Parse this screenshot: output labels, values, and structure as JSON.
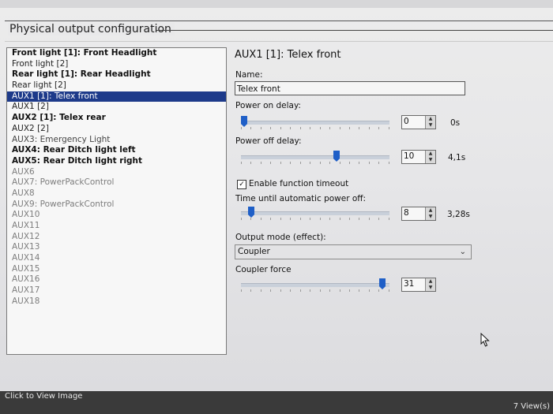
{
  "section_title": "Physical output configuration",
  "outputs": [
    {
      "label": "Front light [1]: Front Headlight",
      "style": "bold"
    },
    {
      "label": "Front light [2]",
      "style": "normal"
    },
    {
      "label": "Rear light [1]: Rear Headlight",
      "style": "bold"
    },
    {
      "label": "Rear light [2]",
      "style": "normal"
    },
    {
      "label": "AUX1 [1]: Telex front",
      "style": "selected"
    },
    {
      "label": "AUX1 [2]",
      "style": "normal"
    },
    {
      "label": "AUX2 [1]: Telex rear",
      "style": "bold"
    },
    {
      "label": "AUX2 [2]",
      "style": "normal"
    },
    {
      "label": "AUX3: Emergency Light",
      "style": "dark"
    },
    {
      "label": "AUX4: Rear Ditch light left",
      "style": "bold"
    },
    {
      "label": "AUX5: Rear Ditch light right",
      "style": "bold"
    },
    {
      "label": "AUX6",
      "style": "gray"
    },
    {
      "label": "AUX7: PowerPackControl",
      "style": "gray"
    },
    {
      "label": "AUX8",
      "style": "gray"
    },
    {
      "label": "AUX9: PowerPackControl",
      "style": "gray"
    },
    {
      "label": "AUX10",
      "style": "gray"
    },
    {
      "label": "AUX11",
      "style": "gray"
    },
    {
      "label": "AUX12",
      "style": "gray"
    },
    {
      "label": "AUX13",
      "style": "gray"
    },
    {
      "label": "AUX14",
      "style": "gray"
    },
    {
      "label": "AUX15",
      "style": "gray"
    },
    {
      "label": "AUX16",
      "style": "gray"
    },
    {
      "label": "AUX17",
      "style": "gray"
    },
    {
      "label": "AUX18",
      "style": "gray"
    }
  ],
  "detail": {
    "heading": "AUX1 [1]: Telex front",
    "name_label": "Name:",
    "name_value": "Telex front",
    "power_on": {
      "label": "Power on delay:",
      "value": "0",
      "unit": "0s",
      "level": 0.0
    },
    "power_off": {
      "label": "Power off delay:",
      "value": "10",
      "unit": "4,1s",
      "level": 0.65
    },
    "timeout_checkbox": {
      "label": "Enable function timeout",
      "checked": true
    },
    "auto_off": {
      "label": "Time until automatic power off:",
      "value": "8",
      "unit": "3,28s",
      "level": 0.05
    },
    "output_mode": {
      "label": "Output mode (effect):",
      "value": "Coupler"
    },
    "coupler_force": {
      "label": "Coupler force",
      "value": "31",
      "level": 0.97
    }
  },
  "footer": {
    "click_text": "Click to View Image",
    "views_text": "7 View(s)"
  },
  "colors": {
    "selection": "#1d3a8a",
    "slider_thumb": "#1f5fc7"
  },
  "icons": {
    "spin_up": "triangle-up",
    "spin_down": "triangle-down",
    "dropdown": "chevron-down",
    "cursor": "mouse-pointer"
  }
}
